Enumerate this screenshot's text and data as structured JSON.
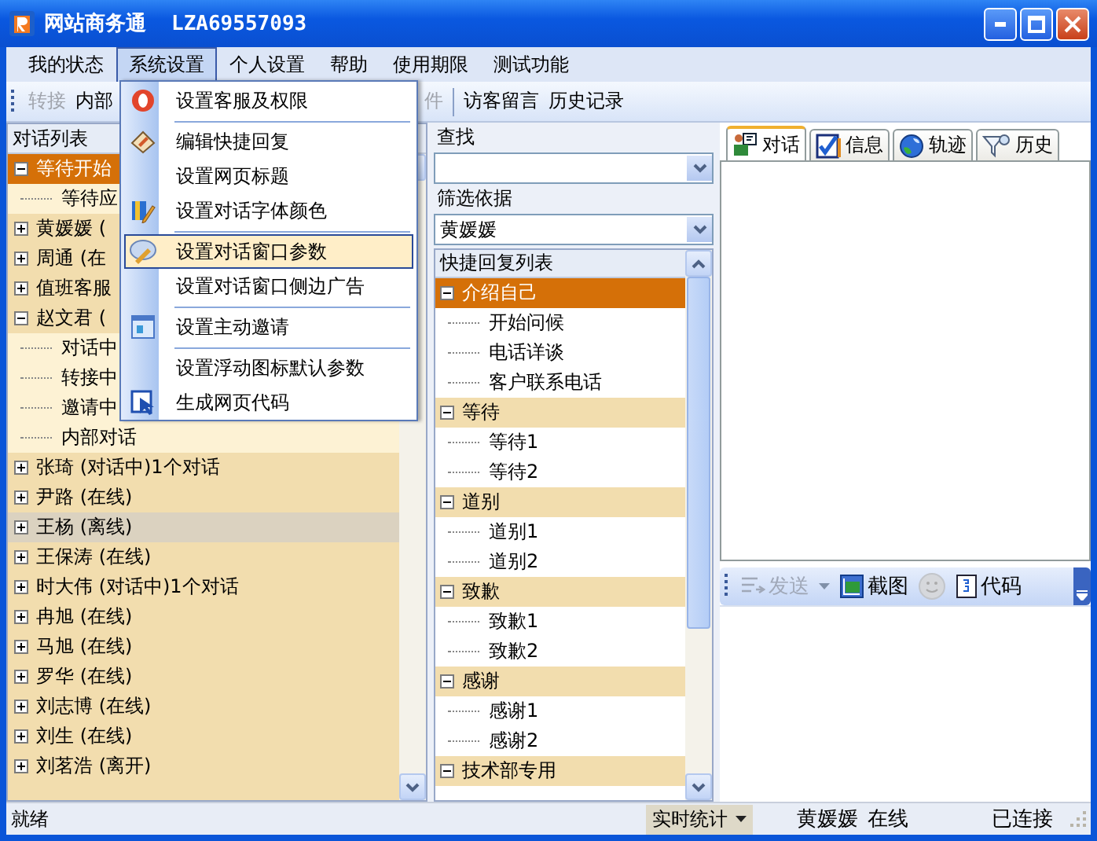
{
  "window": {
    "title": "网站商务通",
    "account": "LZA69557093"
  },
  "menubar": [
    {
      "label": "我的状态",
      "selected": false
    },
    {
      "label": "系统设置",
      "selected": true
    },
    {
      "label": "个人设置",
      "selected": false
    },
    {
      "label": "帮助",
      "selected": false
    },
    {
      "label": "使用期限",
      "selected": false
    },
    {
      "label": "测试功能",
      "selected": false
    }
  ],
  "toolbar": {
    "items": [
      {
        "label": "转接",
        "disabled": true
      },
      {
        "label": "内部",
        "disabled": false
      }
    ],
    "items_right": [
      {
        "label": "件",
        "disabled": true
      },
      {
        "label": "访客留言",
        "disabled": false
      },
      {
        "label": "历史记录",
        "disabled": false
      }
    ]
  },
  "open_menu": {
    "items": [
      {
        "kind": "item",
        "label": "设置客服及权限",
        "selected": false
      },
      {
        "kind": "separator"
      },
      {
        "kind": "item",
        "label": "编辑快捷回复",
        "selected": false
      },
      {
        "kind": "item",
        "label": "设置网页标题",
        "selected": false
      },
      {
        "kind": "item",
        "label": "设置对话字体颜色",
        "selected": false
      },
      {
        "kind": "separator"
      },
      {
        "kind": "item",
        "label": "设置对话窗口参数",
        "selected": true
      },
      {
        "kind": "item",
        "label": "设置对话窗口侧边广告",
        "selected": false
      },
      {
        "kind": "separator"
      },
      {
        "kind": "item",
        "label": "设置主动邀请",
        "selected": false
      },
      {
        "kind": "separator"
      },
      {
        "kind": "item",
        "label": "设置浮动图标默认参数",
        "selected": false
      },
      {
        "kind": "item",
        "label": "生成网页代码",
        "selected": false
      }
    ]
  },
  "conversation_list": {
    "title": "对话列表",
    "rows": [
      {
        "label": "等待开始",
        "selected": true,
        "hovered": false,
        "expanded": true,
        "children": [
          {
            "label": "等待应"
          }
        ]
      },
      {
        "label": "黄媛媛 (",
        "selected": false,
        "hovered": false,
        "expanded": false
      },
      {
        "label": "周通 (在",
        "selected": false,
        "hovered": false,
        "expanded": false
      },
      {
        "label": "值班客服",
        "selected": false,
        "hovered": false,
        "expanded": false
      },
      {
        "label": "赵文君 (",
        "selected": false,
        "hovered": false,
        "expanded": true,
        "children": [
          {
            "label": "对话中"
          },
          {
            "label": "转接中"
          },
          {
            "label": "邀请中"
          },
          {
            "label": "内部对话"
          }
        ]
      },
      {
        "label": "张琦 (对话中)1个对话",
        "selected": false,
        "hovered": false,
        "expanded": false
      },
      {
        "label": "尹路 (在线)",
        "selected": false,
        "hovered": false,
        "expanded": false
      },
      {
        "label": "王杨 (离线)",
        "selected": false,
        "hovered": true,
        "expanded": false
      },
      {
        "label": "王保涛 (在线)",
        "selected": false,
        "hovered": false,
        "expanded": false
      },
      {
        "label": "时大伟 (对话中)1个对话",
        "selected": false,
        "hovered": false,
        "expanded": false
      },
      {
        "label": "冉旭 (在线)",
        "selected": false,
        "hovered": false,
        "expanded": false
      },
      {
        "label": "马旭 (在线)",
        "selected": false,
        "hovered": false,
        "expanded": false
      },
      {
        "label": "罗华 (在线)",
        "selected": false,
        "hovered": false,
        "expanded": false
      },
      {
        "label": "刘志博 (在线)",
        "selected": false,
        "hovered": false,
        "expanded": false
      },
      {
        "label": "刘生 (在线)",
        "selected": false,
        "hovered": false,
        "expanded": false
      },
      {
        "label": "刘茗浩 (离开)",
        "selected": false,
        "hovered": false,
        "expanded": false
      }
    ]
  },
  "search": {
    "label": "查找",
    "filter_label": "筛选依据",
    "filter_value": "黄媛媛"
  },
  "quick_replies": {
    "title": "快捷回复列表",
    "groups": [
      {
        "label": "介绍自己",
        "selected": true,
        "expanded": true,
        "children": [
          {
            "label": "开始问候"
          },
          {
            "label": "电话详谈"
          },
          {
            "label": "客户联系电话"
          }
        ]
      },
      {
        "label": "等待",
        "selected": false,
        "expanded": true,
        "children": [
          {
            "label": "等待1"
          },
          {
            "label": "等待2"
          }
        ]
      },
      {
        "label": "道别",
        "selected": false,
        "expanded": true,
        "children": [
          {
            "label": "道别1"
          },
          {
            "label": "道别2"
          }
        ]
      },
      {
        "label": "致歉",
        "selected": false,
        "expanded": true,
        "children": [
          {
            "label": "致歉1"
          },
          {
            "label": "致歉2"
          }
        ]
      },
      {
        "label": "感谢",
        "selected": false,
        "expanded": true,
        "children": [
          {
            "label": "感谢1"
          },
          {
            "label": "感谢2"
          }
        ]
      },
      {
        "label": "技术部专用",
        "selected": false,
        "expanded": true
      }
    ]
  },
  "chat_tabs": [
    {
      "label": "对话",
      "selected": true
    },
    {
      "label": "信息",
      "selected": false
    },
    {
      "label": "轨迹",
      "selected": false
    },
    {
      "label": "历史",
      "selected": false
    }
  ],
  "chat_toolbar": {
    "send": {
      "label": "发送",
      "disabled": true
    },
    "screenshot": {
      "label": "截图"
    },
    "emoji": {
      "disabled": true
    },
    "code": {
      "label": "代码"
    }
  },
  "status_bar": {
    "status": "就绪",
    "stats_button": "实时统计",
    "user": "黄媛媛",
    "presence": "在线",
    "connection": "已连接"
  }
}
